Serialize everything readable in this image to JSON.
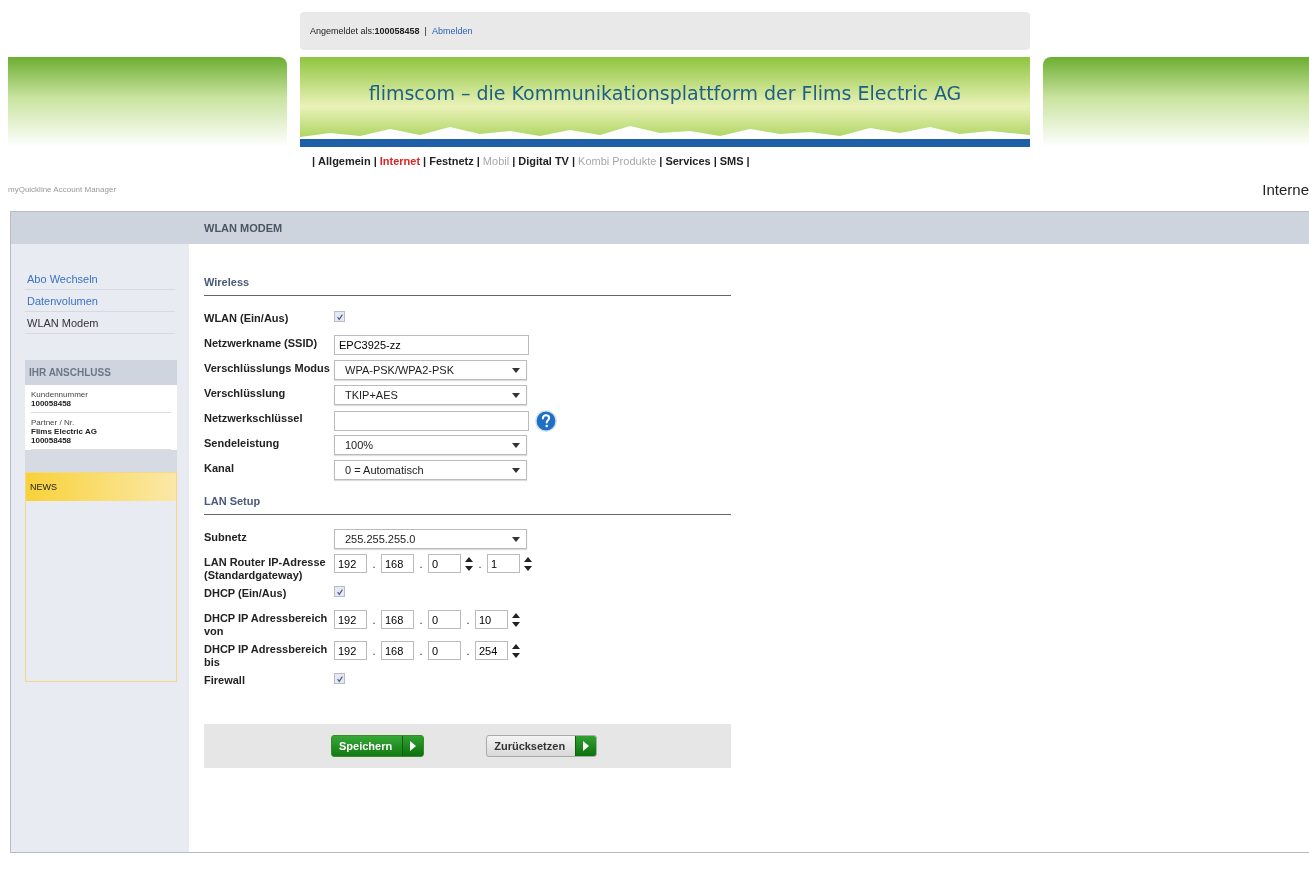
{
  "login_bar": {
    "label": "Angemeldet als:",
    "user": "100058458",
    "separator": "|",
    "logout_link": "Abmelden"
  },
  "banner": {
    "title": "flimscom – die Kommunikationsplattform der Flims Electric AG"
  },
  "nav": {
    "separator": "|",
    "items": [
      {
        "label": "Allgemein",
        "selected": false,
        "disabled": false
      },
      {
        "label": "Internet",
        "selected": true,
        "disabled": false
      },
      {
        "label": "Festnetz",
        "selected": false,
        "disabled": false
      },
      {
        "label": "Mobil",
        "selected": false,
        "disabled": true
      },
      {
        "label": "Digital TV",
        "selected": false,
        "disabled": false
      },
      {
        "label": "Kombi Produkte",
        "selected": false,
        "disabled": true
      },
      {
        "label": "Services",
        "selected": false,
        "disabled": false
      },
      {
        "label": "SMS",
        "selected": false,
        "disabled": false
      }
    ]
  },
  "app_title": "myQuickline Account Manager",
  "section_title": "Interne",
  "panel_title": "WLAN MODEM",
  "sidebar": {
    "items": [
      {
        "label": "Abo Wechseln",
        "selected": false
      },
      {
        "label": "Datenvolumen",
        "selected": false
      },
      {
        "label": "WLAN Modem",
        "selected": true
      }
    ],
    "connection": {
      "title": "IHR ANSCHLUSS",
      "entries": [
        {
          "label": "Kundennummer",
          "values": [
            "100058458"
          ]
        },
        {
          "label": "Partner / Nr.",
          "values": [
            "Flims Electric AG",
            "100058458"
          ]
        }
      ]
    },
    "news": {
      "title": "NEWS"
    }
  },
  "sections": [
    {
      "title": "Wireless",
      "rows": [
        {
          "kind": "checkbox",
          "label": "WLAN (Ein/Aus)",
          "checked": true
        },
        {
          "kind": "text",
          "label": "Netzwerkname (SSID)",
          "value": "EPC3925-zz"
        },
        {
          "kind": "select",
          "label": "Verschlüsslungs Modus",
          "value": "WPA-PSK/WPA2-PSK"
        },
        {
          "kind": "select",
          "label": "Verschlüsslung",
          "value": "TKIP+AES"
        },
        {
          "kind": "help",
          "label": "Netzwerkschlüssel",
          "value": ""
        },
        {
          "kind": "select",
          "label": "Sendeleistung",
          "value": "100%"
        },
        {
          "kind": "select",
          "label": "Kanal",
          "value": "0 = Automatisch"
        }
      ]
    },
    {
      "title": "LAN Setup",
      "rows": [
        {
          "kind": "select",
          "label": "Subnetz",
          "value": "255.255.255.0"
        },
        {
          "kind": "ip",
          "label": "LAN Router IP-Adresse (Standardgateway)",
          "separator": ".",
          "octets": [
            {
              "value": "192",
              "spinner": false
            },
            {
              "value": "168",
              "spinner": false
            },
            {
              "value": "0",
              "spinner": true
            },
            {
              "value": "1",
              "spinner": true
            }
          ]
        },
        {
          "kind": "checkbox",
          "label": "DHCP (Ein/Aus)",
          "checked": true
        },
        {
          "kind": "ip",
          "label": "DHCP IP Adressbereich von",
          "separator": ".",
          "octets": [
            {
              "value": "192",
              "spinner": false
            },
            {
              "value": "168",
              "spinner": false
            },
            {
              "value": "0",
              "spinner": false
            },
            {
              "value": "10",
              "spinner": true
            }
          ]
        },
        {
          "kind": "ip",
          "label": "DHCP IP Adressbereich bis",
          "separator": ".",
          "octets": [
            {
              "value": "192",
              "spinner": false
            },
            {
              "value": "168",
              "spinner": false
            },
            {
              "value": "0",
              "spinner": false
            },
            {
              "value": "254",
              "spinner": true
            }
          ]
        },
        {
          "kind": "checkbox",
          "label": "Firewall",
          "checked": true
        }
      ]
    }
  ],
  "buttons": [
    {
      "label": "Speichern",
      "kind": "primary"
    },
    {
      "label": "Zurücksetzen",
      "kind": "secondary"
    }
  ]
}
